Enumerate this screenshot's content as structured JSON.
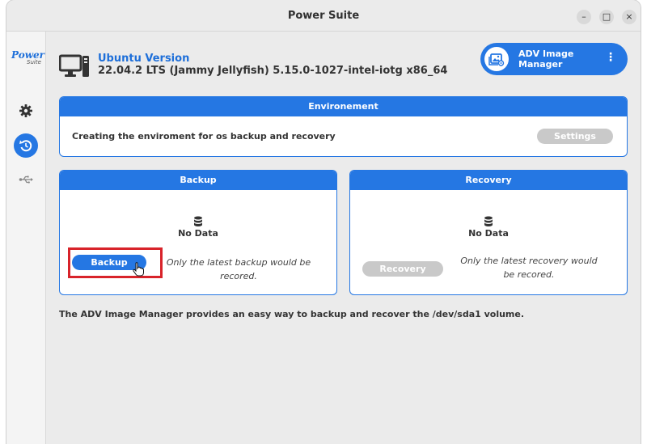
{
  "window": {
    "title": "Power Suite"
  },
  "controls": {
    "minimize": "–",
    "maximize": "□",
    "close": "×"
  },
  "logo": {
    "line1": "Power",
    "line2": "Suite"
  },
  "sidebar": {
    "items": [
      {
        "icon": "gear-icon"
      },
      {
        "icon": "restore-icon",
        "active": true
      },
      {
        "icon": "usb-icon"
      }
    ]
  },
  "version": {
    "title": "Ubuntu Version",
    "text": "22.04.2 LTS (Jammy Jellyfish) 5.15.0-1027-intel-iotg x86_64"
  },
  "adv_button": {
    "label": "ADV Image Manager",
    "menu": "⋮"
  },
  "environment": {
    "header": "Environement",
    "text": "Creating the enviroment for os backup and recovery",
    "settings_label": "Settings"
  },
  "backup": {
    "header": "Backup",
    "status": "No Data",
    "button_label": "Backup",
    "note": "Only the latest backup would be recored."
  },
  "recovery": {
    "header": "Recovery",
    "status": "No Data",
    "button_label": "Recovery",
    "note": "Only the latest recovery would be recored."
  },
  "footer": {
    "text": "The ADV Image Manager provides an easy way to backup and recover the /dev/sda1 volume."
  },
  "colors": {
    "accent": "#2577e3",
    "highlight": "#d8232a",
    "disabled": "#c9c9c9"
  }
}
